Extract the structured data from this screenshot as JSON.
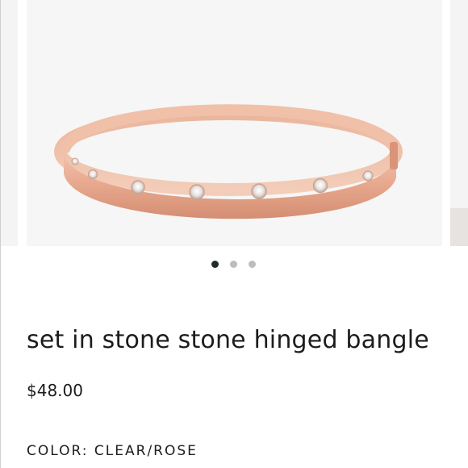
{
  "gallery": {
    "image_alt": "rose gold bangle with clear crystal studs",
    "dots_count": 3,
    "active_index": 0
  },
  "product": {
    "title": "set in stone stone hinged bangle",
    "price": "$48.00",
    "color_label": "COLOR:",
    "color_value": "CLEAR/ROSE"
  },
  "colors": {
    "dot_active": "#1f2e25",
    "dot_inactive": "#bdbdbd",
    "rose_gold": "#e3a48a"
  }
}
